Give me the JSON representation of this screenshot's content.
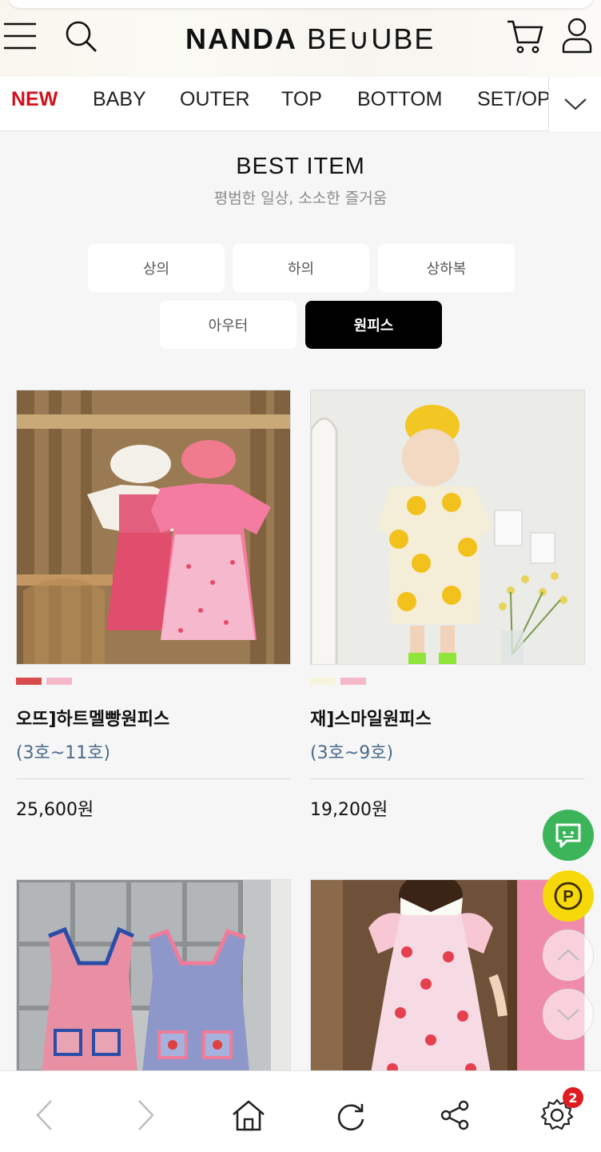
{
  "header": {
    "logo_bold": "NANDA",
    "logo_rest": "BE∪UBE",
    "menu_icon": "hamburger-icon",
    "search_icon": "search-icon",
    "cart_icon": "cart-icon",
    "user_icon": "user-icon"
  },
  "categories": [
    {
      "label": "NEW",
      "active": true
    },
    {
      "label": "BABY"
    },
    {
      "label": "OUTER"
    },
    {
      "label": "TOP"
    },
    {
      "label": "BOTTOM"
    },
    {
      "label": "SET/OP"
    }
  ],
  "best": {
    "title": "BEST ITEM",
    "subtitle": "평범한 일상, 소소한 즐거움"
  },
  "filters": [
    {
      "label": "상의"
    },
    {
      "label": "하의"
    },
    {
      "label": "상하복"
    },
    {
      "label": "아우터"
    },
    {
      "label": "원피스",
      "active": true
    }
  ],
  "products": [
    {
      "name": "오뜨]하트멜빵원피스",
      "size": "(3호~11호)",
      "price": "25,600원",
      "swatches": [
        "#d94b4b",
        "#f5b8c8"
      ]
    },
    {
      "name": "재]스마일원피스",
      "size": "(3호~9호)",
      "price": "19,200원",
      "swatches": [
        "#f7f4dc",
        "#f5b8c8"
      ]
    },
    {
      "name": "",
      "size": "",
      "price": "",
      "swatches": []
    },
    {
      "name": "",
      "size": "",
      "price": "",
      "swatches": []
    }
  ],
  "fab": {
    "chat_icon": "chat-icon",
    "point_icon": "point-icon",
    "scroll_up_icon": "chevron-up-icon",
    "scroll_down_icon": "chevron-down-icon"
  },
  "bottom_bar": {
    "settings_badge": "2"
  },
  "colors": {
    "accent_red": "#d1121d",
    "chat_green": "#3cb55a",
    "point_yellow": "#f5d90a"
  }
}
